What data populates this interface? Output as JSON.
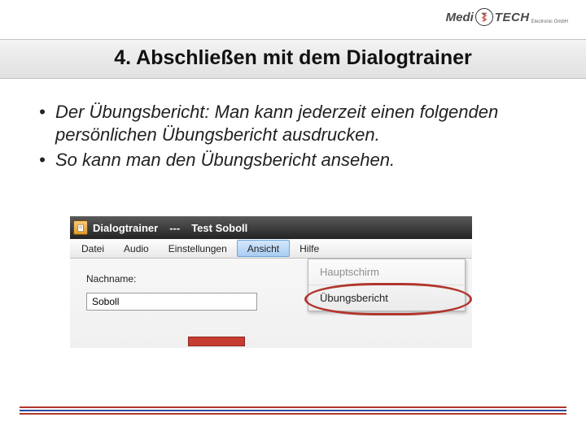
{
  "logo": {
    "left": "Medi",
    "right": "TECH",
    "sub": "Electronic GmbH"
  },
  "title": "4. Abschließen mit dem Dialogtrainer",
  "bullets": [
    "Der Übungsbericht: Man kann jederzeit einen folgenden persönlichen Übungsbericht ausdrucken.",
    "So kann man den Übungsbericht ansehen."
  ],
  "window": {
    "app_name": "Dialogtrainer",
    "separator": "---",
    "user": "Test Soboll",
    "menu": [
      "Datei",
      "Audio",
      "Einstellungen",
      "Ansicht",
      "Hilfe"
    ],
    "active_menu_index": 3,
    "field_label": "Nachname:",
    "field_value": "Soboll",
    "dropdown": {
      "items": [
        "Hauptschirm",
        "Übungsbericht"
      ]
    }
  }
}
